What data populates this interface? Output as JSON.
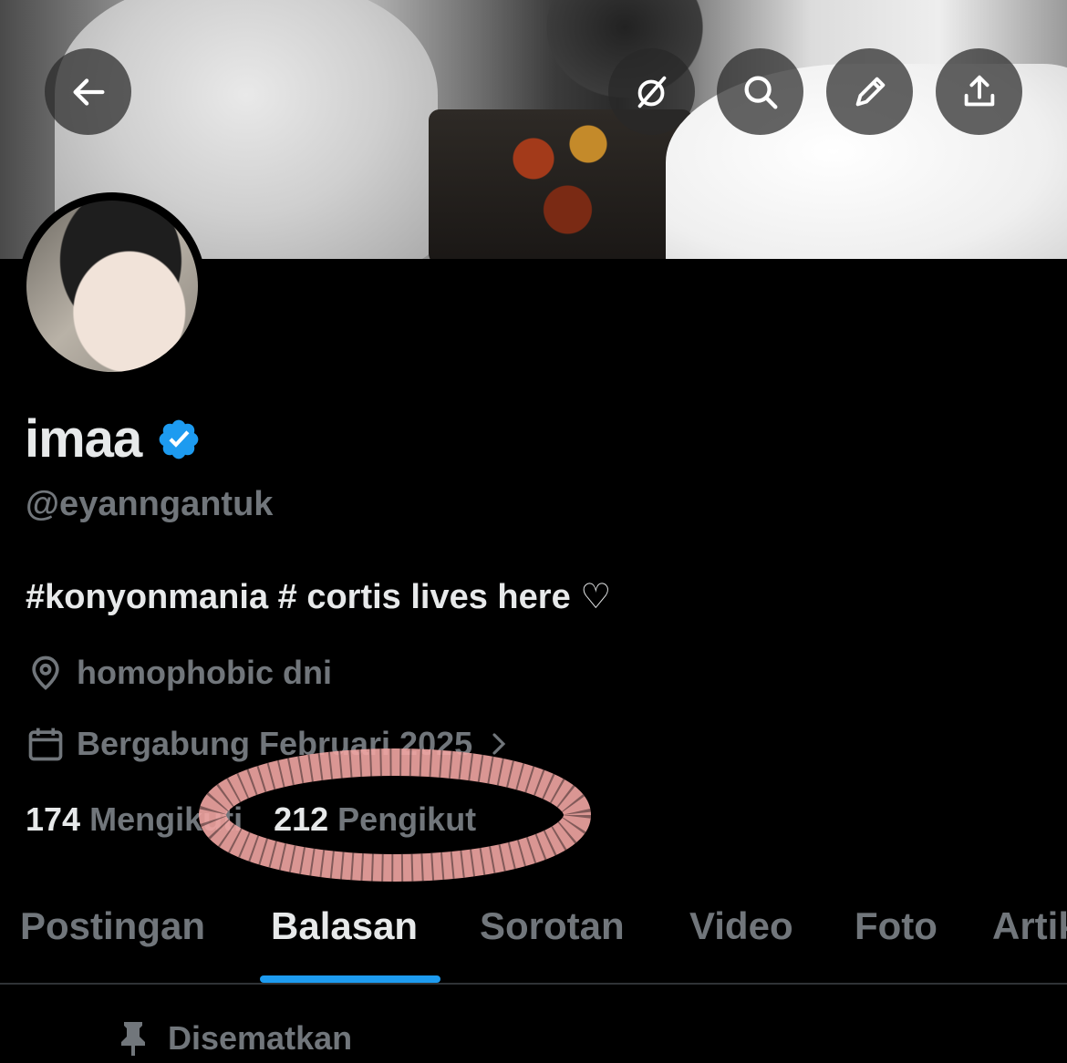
{
  "header": {
    "buttons": [
      {
        "name": "back-button",
        "icon": "arrow-left-icon"
      },
      {
        "name": "grok-button",
        "icon": "grok-slash-icon"
      },
      {
        "name": "search-button",
        "icon": "search-icon"
      },
      {
        "name": "edit-button",
        "icon": "pencil-icon"
      },
      {
        "name": "share-button",
        "icon": "share-upload-icon"
      }
    ]
  },
  "profile": {
    "display_name": "imaa",
    "handle": "@eyanngantuk",
    "verified_color": "#1d9bf0",
    "bio": "#konyonmania # cortis lives here ♡",
    "location": "homophobic dni",
    "joined": "Bergabung Februari 2025",
    "following_count": "174",
    "following_label": "Mengikuti",
    "followers_count": "212",
    "followers_label": "Pengikut"
  },
  "tabs": [
    {
      "label": "Postingan",
      "active": false
    },
    {
      "label": "Balasan",
      "active": true
    },
    {
      "label": "Sorotan",
      "active": false
    },
    {
      "label": "Video",
      "active": false
    },
    {
      "label": "Foto",
      "active": false
    },
    {
      "label": "Artikel",
      "active": false
    }
  ],
  "pinned_label": "Disematkan",
  "accent": "#1d9bf0"
}
